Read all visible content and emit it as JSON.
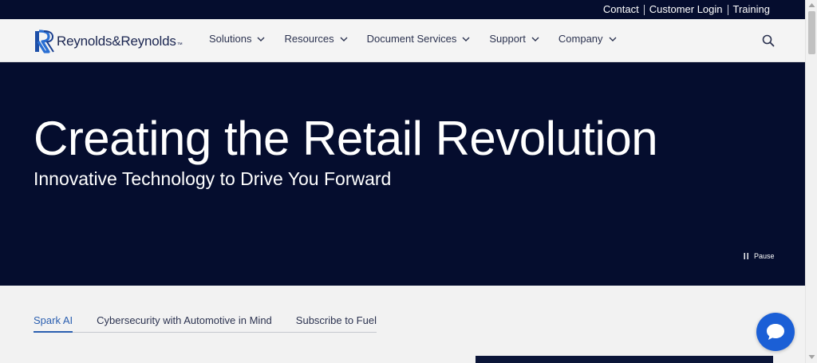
{
  "utility_nav": {
    "contact": "Contact",
    "customer_login": "Customer Login",
    "training": "Training"
  },
  "header": {
    "logo_text": "Reynolds&Reynolds",
    "logo_tm": "™",
    "nav": [
      {
        "label": "Solutions"
      },
      {
        "label": "Resources"
      },
      {
        "label": "Document Services"
      },
      {
        "label": "Support"
      },
      {
        "label": "Company"
      }
    ],
    "search_icon": "search-icon"
  },
  "hero": {
    "title": "Creating the Retail Revolution",
    "subtitle": "Innovative Technology to Drive You Forward",
    "pause_label": "Pause"
  },
  "tabs": [
    {
      "label": "Spark AI",
      "active": true
    },
    {
      "label": "Cybersecurity with Automotive in Mind",
      "active": false
    },
    {
      "label": "Subscribe to Fuel",
      "active": false
    }
  ],
  "colors": {
    "navy": "#050d2e",
    "accent": "#2b5fb0",
    "chat": "#1b5fd6"
  }
}
